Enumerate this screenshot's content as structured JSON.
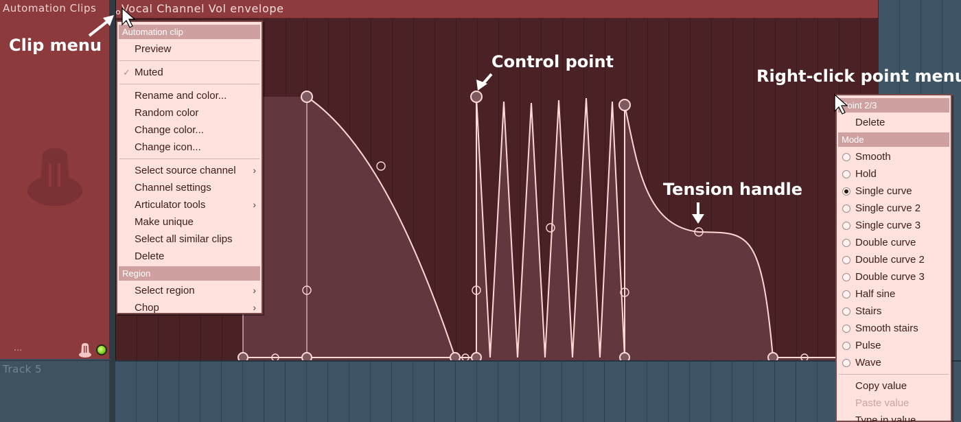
{
  "tracks": {
    "automation_header": "Automation Clips",
    "automation_dots": "...",
    "track5_header": "Track 5"
  },
  "clip": {
    "title": "Vocal Channel Vol envelope"
  },
  "clip_menu": {
    "section_automation": "Automation clip",
    "preview": "Preview",
    "muted": "Muted",
    "rename_and_color": "Rename and color...",
    "random_color": "Random color",
    "change_color": "Change color...",
    "change_icon": "Change icon...",
    "select_source_channel": "Select source channel",
    "channel_settings": "Channel settings",
    "articulator_tools": "Articulator tools",
    "make_unique": "Make unique",
    "select_all_similar": "Select all similar clips",
    "delete": "Delete",
    "section_region": "Region",
    "select_region": "Select region",
    "chop": "Chop",
    "check_glyph": "✓",
    "arrow_glyph": "›"
  },
  "point_menu": {
    "header": "Point 2/3",
    "delete": "Delete",
    "section_mode": "Mode",
    "modes": [
      {
        "label": "Smooth",
        "selected": false
      },
      {
        "label": "Hold",
        "selected": false
      },
      {
        "label": "Single curve",
        "selected": true
      },
      {
        "label": "Single curve 2",
        "selected": false
      },
      {
        "label": "Single curve 3",
        "selected": false
      },
      {
        "label": "Double curve",
        "selected": false
      },
      {
        "label": "Double curve 2",
        "selected": false
      },
      {
        "label": "Double curve 3",
        "selected": false
      },
      {
        "label": "Half sine",
        "selected": false
      },
      {
        "label": "Stairs",
        "selected": false
      },
      {
        "label": "Smooth stairs",
        "selected": false
      },
      {
        "label": "Pulse",
        "selected": false
      },
      {
        "label": "Wave",
        "selected": false
      }
    ],
    "copy_value": "Copy value",
    "paste_value": "Paste value",
    "type_in_value": "Type in value..."
  },
  "annotations": {
    "clip_menu": "Clip menu",
    "control_point": "Control point",
    "tension_handle": "Tension handle",
    "right_click_menu": "Right-click point menu"
  },
  "colors": {
    "clip_body": "#4a2226",
    "clip_title_bar": "#8e3b3e",
    "envelope_line": "#ffd9d6",
    "menu_background": "#ffe2de",
    "menu_section": "#cfa0a0",
    "grid_blue": "#3d5565",
    "led_green": "#7ecf22"
  }
}
